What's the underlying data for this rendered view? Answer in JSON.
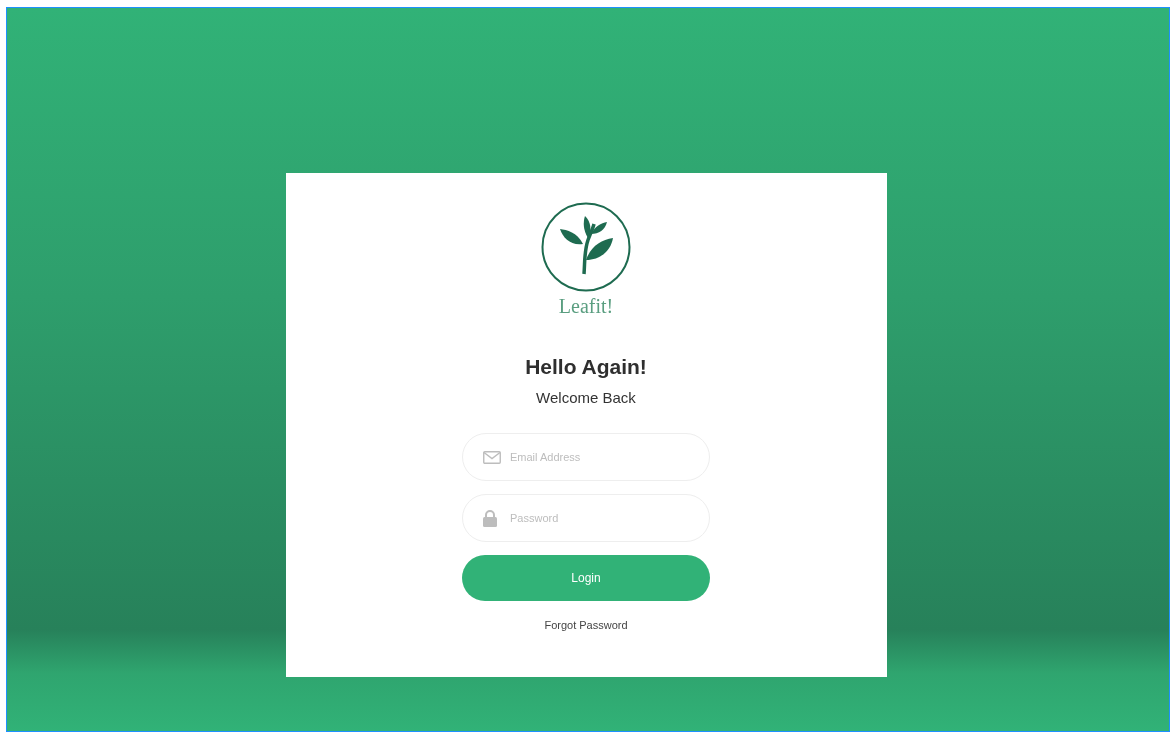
{
  "brand": {
    "name": "Leafit!"
  },
  "heading": "Hello Again!",
  "subheading": "Welcome Back",
  "fields": [
    {
      "kind": "email",
      "placeholder": "Email Address"
    },
    {
      "kind": "password",
      "placeholder": "Password"
    }
  ],
  "login_button": "Login",
  "forgot_link": "Forgot Password"
}
